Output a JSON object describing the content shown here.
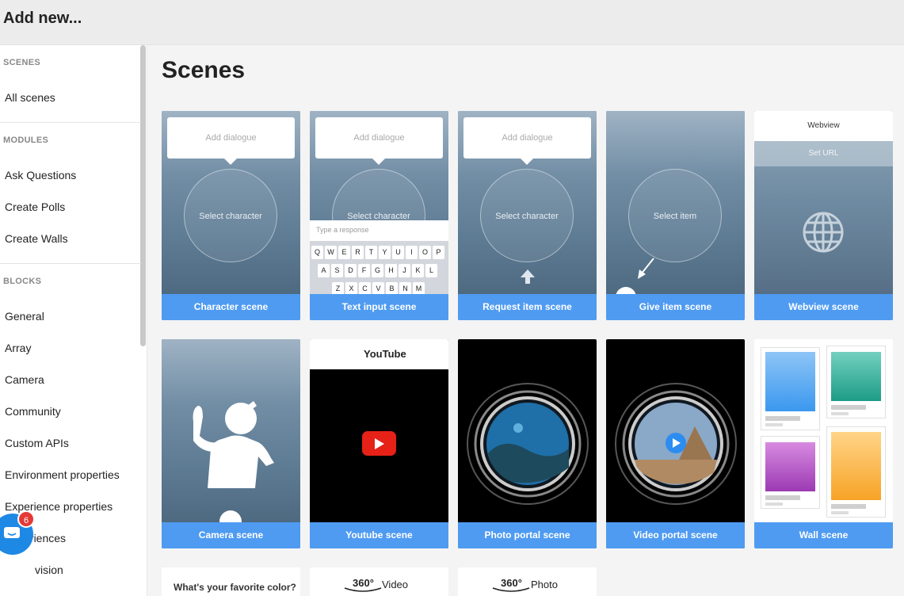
{
  "header": {
    "title": "Add new..."
  },
  "sidebar": {
    "scenes_head": "SCENES",
    "all_scenes": "All scenes",
    "modules_head": "MODULES",
    "modules": [
      "Ask Questions",
      "Create Polls",
      "Create Walls"
    ],
    "blocks_head": "BLOCKS",
    "blocks": [
      "General",
      "Array",
      "Camera",
      "Community",
      "Custom APIs",
      "Environment properties",
      "Experience properties",
      "Experiences",
      "vision"
    ]
  },
  "chat": {
    "badge": "6"
  },
  "main": {
    "title": "Scenes",
    "cards": [
      {
        "label": "Character scene",
        "bubble": "Add dialogue",
        "circle": "Select character"
      },
      {
        "label": "Text input scene",
        "bubble": "Add dialogue",
        "circle": "Select character",
        "placeholder": "Type a response"
      },
      {
        "label": "Request item scene",
        "bubble": "Add dialogue",
        "circle": "Select character"
      },
      {
        "label": "Give item scene",
        "circle": "Select item"
      },
      {
        "label": "Webview scene",
        "title": "Webview",
        "url_button": "Set URL"
      },
      {
        "label": "Camera scene"
      },
      {
        "label": "Youtube scene",
        "logo": "YouTube"
      },
      {
        "label": "Photo portal scene"
      },
      {
        "label": "Video portal scene"
      },
      {
        "label": "Wall scene"
      }
    ],
    "partial_cards": [
      {
        "text": "What's your favorite color?"
      },
      {
        "badge": "360°",
        "text": "Video"
      },
      {
        "badge": "360°",
        "text": "Photo"
      }
    ]
  },
  "keyboard": {
    "rows": [
      [
        "Q",
        "W",
        "E",
        "R",
        "T",
        "Y",
        "U",
        "I",
        "O",
        "P"
      ],
      [
        "A",
        "S",
        "D",
        "F",
        "G",
        "H",
        "J",
        "K",
        "L"
      ],
      [
        "Z",
        "X",
        "C",
        "V",
        "B",
        "N",
        "M"
      ]
    ]
  },
  "colors": {
    "accent": "#4f9bf1",
    "chat": "#1e88e5",
    "badge": "#e53935"
  }
}
